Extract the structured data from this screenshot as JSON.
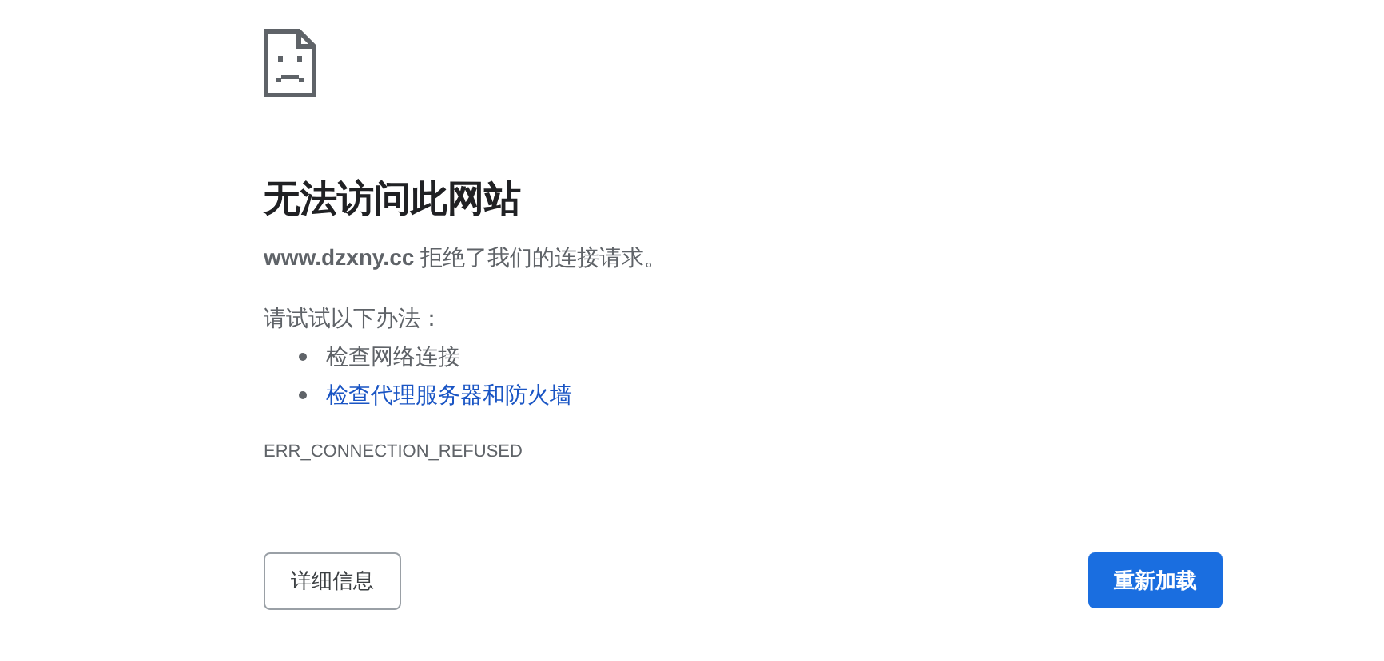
{
  "title": "无法访问此网站",
  "message": "**www.dzxny.cc** 拒绝了我们的连接请求。",
  "suggestions_heading": "请试试以下办法：",
  "suggestions": [
    {
      "kind": "text",
      "label": "检查网络连接"
    },
    {
      "kind": "link",
      "label": "检查代理服务器和防火墙"
    }
  ],
  "error_code": "ERR_CONNECTION_REFUSED",
  "buttons": [
    {
      "kind": "secondary",
      "label": "详细信息"
    },
    {
      "kind": "primary",
      "label": "重新加载"
    }
  ]
}
